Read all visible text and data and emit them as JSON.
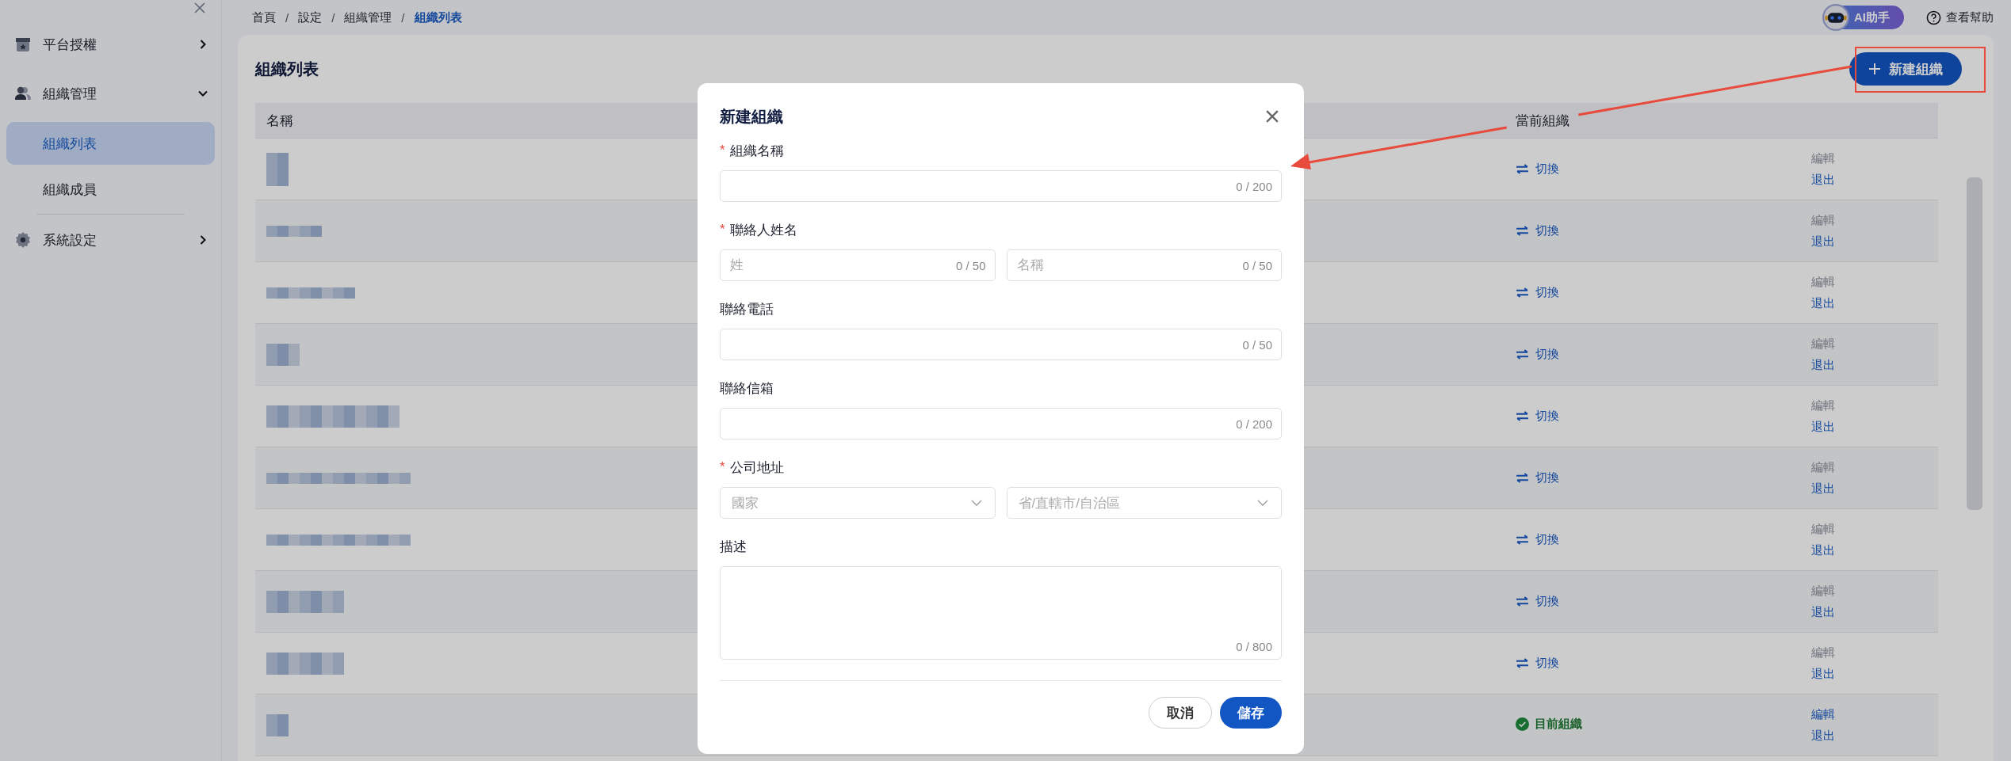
{
  "sidebar": {
    "items": [
      {
        "label": "平台授權",
        "expanded": false
      },
      {
        "label": "組織管理",
        "expanded": true,
        "children": [
          {
            "label": "組織列表",
            "selected": true
          },
          {
            "label": "組織成員",
            "selected": false
          }
        ]
      },
      {
        "label": "系統設定",
        "expanded": false
      }
    ]
  },
  "breadcrumb": [
    {
      "label": "首頁",
      "selected": false
    },
    {
      "separator": "/",
      "label": "設定",
      "selected": false
    },
    {
      "separator": "/",
      "label": "組織管理",
      "selected": false
    },
    {
      "separator": "/",
      "label": "組織列表",
      "selected": true
    }
  ],
  "header": {
    "assistant": "AI助手",
    "help": "查看幫助"
  },
  "page": {
    "title": "組織列表",
    "new_button": "新建組織"
  },
  "table": {
    "columns": [
      "名稱",
      "當前組織"
    ],
    "rows": [
      {
        "status": {
          "kind": "switch",
          "label": "切換"
        },
        "actions": [
          {
            "label": "編輯",
            "disabled": true
          },
          {
            "label": "退出",
            "disabled": false
          }
        ]
      },
      {
        "status": {
          "kind": "switch",
          "label": "切換"
        },
        "actions": [
          {
            "label": "編輯",
            "disabled": true
          },
          {
            "label": "退出",
            "disabled": false
          }
        ]
      },
      {
        "status": {
          "kind": "switch",
          "label": "切換"
        },
        "actions": [
          {
            "label": "編輯",
            "disabled": true
          },
          {
            "label": "退出",
            "disabled": false
          }
        ]
      },
      {
        "status": {
          "kind": "switch",
          "label": "切換"
        },
        "actions": [
          {
            "label": "編輯",
            "disabled": true
          },
          {
            "label": "退出",
            "disabled": false
          }
        ]
      },
      {
        "status": {
          "kind": "switch",
          "label": "切換"
        },
        "actions": [
          {
            "label": "編輯",
            "disabled": true
          },
          {
            "label": "退出",
            "disabled": false
          }
        ]
      },
      {
        "status": {
          "kind": "switch",
          "label": "切換"
        },
        "actions": [
          {
            "label": "編輯",
            "disabled": true
          },
          {
            "label": "退出",
            "disabled": false
          }
        ]
      },
      {
        "status": {
          "kind": "switch",
          "label": "切換"
        },
        "actions": [
          {
            "label": "編輯",
            "disabled": true
          },
          {
            "label": "退出",
            "disabled": false
          }
        ]
      },
      {
        "status": {
          "kind": "switch",
          "label": "切換"
        },
        "actions": [
          {
            "label": "編輯",
            "disabled": true
          },
          {
            "label": "退出",
            "disabled": false
          }
        ]
      },
      {
        "status": {
          "kind": "switch",
          "label": "切換"
        },
        "actions": [
          {
            "label": "編輯",
            "disabled": true
          },
          {
            "label": "退出",
            "disabled": false
          }
        ]
      },
      {
        "status": {
          "kind": "current",
          "label": "目前組織"
        },
        "actions": [
          {
            "label": "編輯",
            "disabled": false
          },
          {
            "label": "退出",
            "disabled": false
          }
        ]
      }
    ]
  },
  "modal": {
    "title": "新建組織",
    "fields": [
      {
        "required_mark": "*",
        "label": "組織名稱",
        "kind": "input",
        "parts": [
          {
            "counter": "0 / 200"
          }
        ]
      },
      {
        "required_mark": "*",
        "label": "聯絡人姓名",
        "kind": "input",
        "parts": [
          {
            "placeholder": "姓",
            "counter": "0 / 50"
          },
          {
            "placeholder": "名稱",
            "counter": "0 / 50"
          }
        ]
      },
      {
        "label": "聯絡電話",
        "kind": "input",
        "parts": [
          {
            "counter": "0 / 50"
          }
        ]
      },
      {
        "label": "聯絡信箱",
        "kind": "input",
        "parts": [
          {
            "counter": "0 / 200"
          }
        ]
      },
      {
        "required_mark": "*",
        "label": "公司地址",
        "kind": "select",
        "parts": [
          {
            "placeholder": "國家"
          },
          {
            "placeholder": "省/直轄市/自治區"
          }
        ]
      },
      {
        "label": "描述",
        "kind": "textarea",
        "parts": [
          {
            "counter": "0 / 800"
          }
        ]
      }
    ],
    "buttons": [
      {
        "label": "取消",
        "kind": "secondary"
      },
      {
        "label": "儲存",
        "kind": "primary"
      }
    ]
  }
}
